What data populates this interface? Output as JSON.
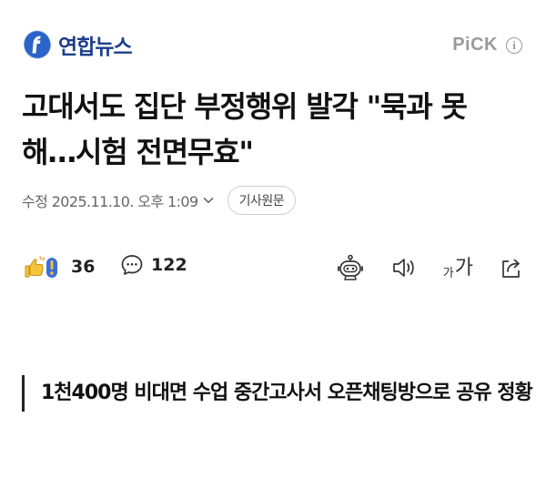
{
  "header": {
    "brand": "연합뉴스",
    "pick_label": "PiCK",
    "info_glyph": "i",
    "logo_icon": "yonhap-logo-icon",
    "info_icon": "info-circle-icon"
  },
  "article": {
    "title": "고대서도 집단 부정행위 발각 \"묵과 못 해…시험 전면무효\"",
    "modified_date": "수정 2025.11.10. 오후 1:09",
    "original_button": "기사원문",
    "subtitle": "1천400명 비대면 수업 중간고사서 오픈채팅방으로 공유 정황"
  },
  "actions": {
    "reaction_count": "36",
    "comment_count": "122",
    "font_small": "가",
    "font_big": "가",
    "icons": [
      "reaction-icon",
      "comment-icon",
      "robot-summary-icon",
      "speaker-icon",
      "font-size-icon",
      "share-icon"
    ]
  },
  "colors": {
    "brand": "#1d3f8a",
    "pick": "#9a9a9a",
    "text": "#111111",
    "meta": "#666666",
    "reaction_yellow": "#f5c33b",
    "reaction_blue": "#3b6fd8"
  }
}
